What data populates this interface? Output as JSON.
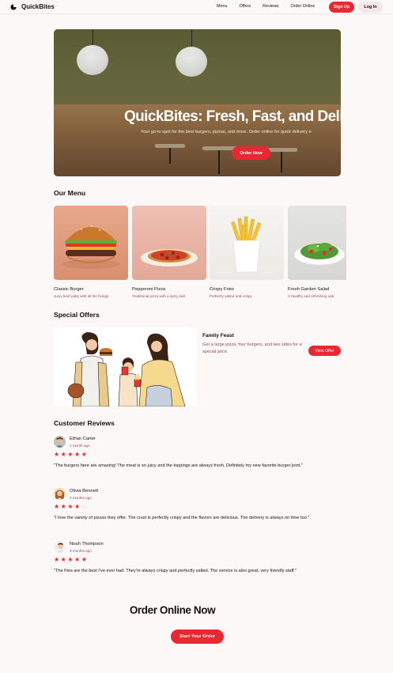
{
  "brand": {
    "name": "QuickBites"
  },
  "nav": {
    "menu": "Menu",
    "offers": "Offers",
    "reviews": "Reviews",
    "order_online": "Order Online"
  },
  "auth": {
    "signup": "Sign Up",
    "login": "Log In"
  },
  "hero": {
    "title": "QuickBites: Fresh, Fast, and Deli",
    "subtitle": "Your go-to spot for the best burgers, pizzas, and more. Order online for quick delivery o",
    "cta": "Order Now"
  },
  "menu_section": {
    "title": "Our Menu",
    "items": [
      {
        "name": "Classic Burger",
        "desc": "Juicy beef patty with all the fixings"
      },
      {
        "name": "Pepperoni Pizza",
        "desc": "Traditional pizza with a spicy kick"
      },
      {
        "name": "Crispy Fries",
        "desc": "Perfectly salted and crispy"
      },
      {
        "name": "Fresh Garden Salad",
        "desc": "A healthy and refreshing opti"
      }
    ]
  },
  "offers_section": {
    "title": "Special Offers",
    "offer_title": "Family Feast",
    "offer_desc": "Get a large pizza, four burgers, and two sides for a special price.",
    "offer_button": "View Offer"
  },
  "reviews_section": {
    "title": "Customer Reviews",
    "reviews": [
      {
        "name": "Ethan Carter",
        "time": "1 month ago",
        "rating": 5,
        "text": "\"The burgers here are amazing! The meat is so juicy and the toppings are always fresh. Definitely my new favorite burger joint.\""
      },
      {
        "name": "Olivia Bennett",
        "time": "2 months ago",
        "rating": 4,
        "text": "\"I love the variety of pizzas they offer. The crust is perfectly crispy and the flavors are delicious. The delivery is always on time too.\""
      },
      {
        "name": "Noah Thompson",
        "time": "3 months ago",
        "rating": 5,
        "text": "\"The fries are the best I've ever had. They're always crispy and perfectly salted. The service is also great, very friendly staff.\""
      }
    ]
  },
  "order_section": {
    "title": "Order Online Now",
    "button": "Start Your Order"
  },
  "colors": {
    "accent": "#e92931",
    "muted_text": "#994d51",
    "background": "#fcf8f8",
    "secondary_button": "#f3e7e8"
  }
}
